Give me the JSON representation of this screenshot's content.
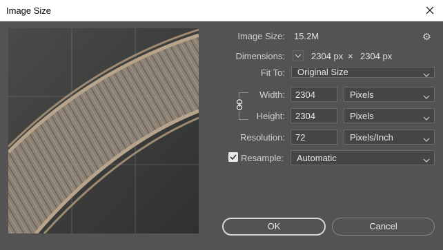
{
  "window": {
    "title": "Image Size"
  },
  "image_size": {
    "label": "Image Size:",
    "value": "15.2M"
  },
  "dimensions": {
    "label": "Dimensions:",
    "width_value": "2304 px",
    "times": "×",
    "height_value": "2304 px"
  },
  "fit_to": {
    "label": "Fit To:",
    "selected": "Original Size"
  },
  "width": {
    "label": "Width:",
    "value": "2304",
    "unit": "Pixels"
  },
  "height": {
    "label": "Height:",
    "value": "2304",
    "unit": "Pixels"
  },
  "resolution": {
    "label": "Resolution:",
    "value": "72",
    "unit": "Pixels/Inch"
  },
  "resample": {
    "label": "Resample:",
    "checked": true,
    "selected": "Automatic"
  },
  "buttons": {
    "ok": "OK",
    "cancel": "Cancel"
  },
  "icons": {
    "close": "close-icon",
    "gear": "gear-icon",
    "chain": "link-chain-icon",
    "chevron": "chevron-down-icon",
    "check": "check-icon"
  },
  "colors": {
    "panel_bg": "#535353",
    "field_bg": "#454545",
    "titlebar_bg": "#ffffff"
  }
}
